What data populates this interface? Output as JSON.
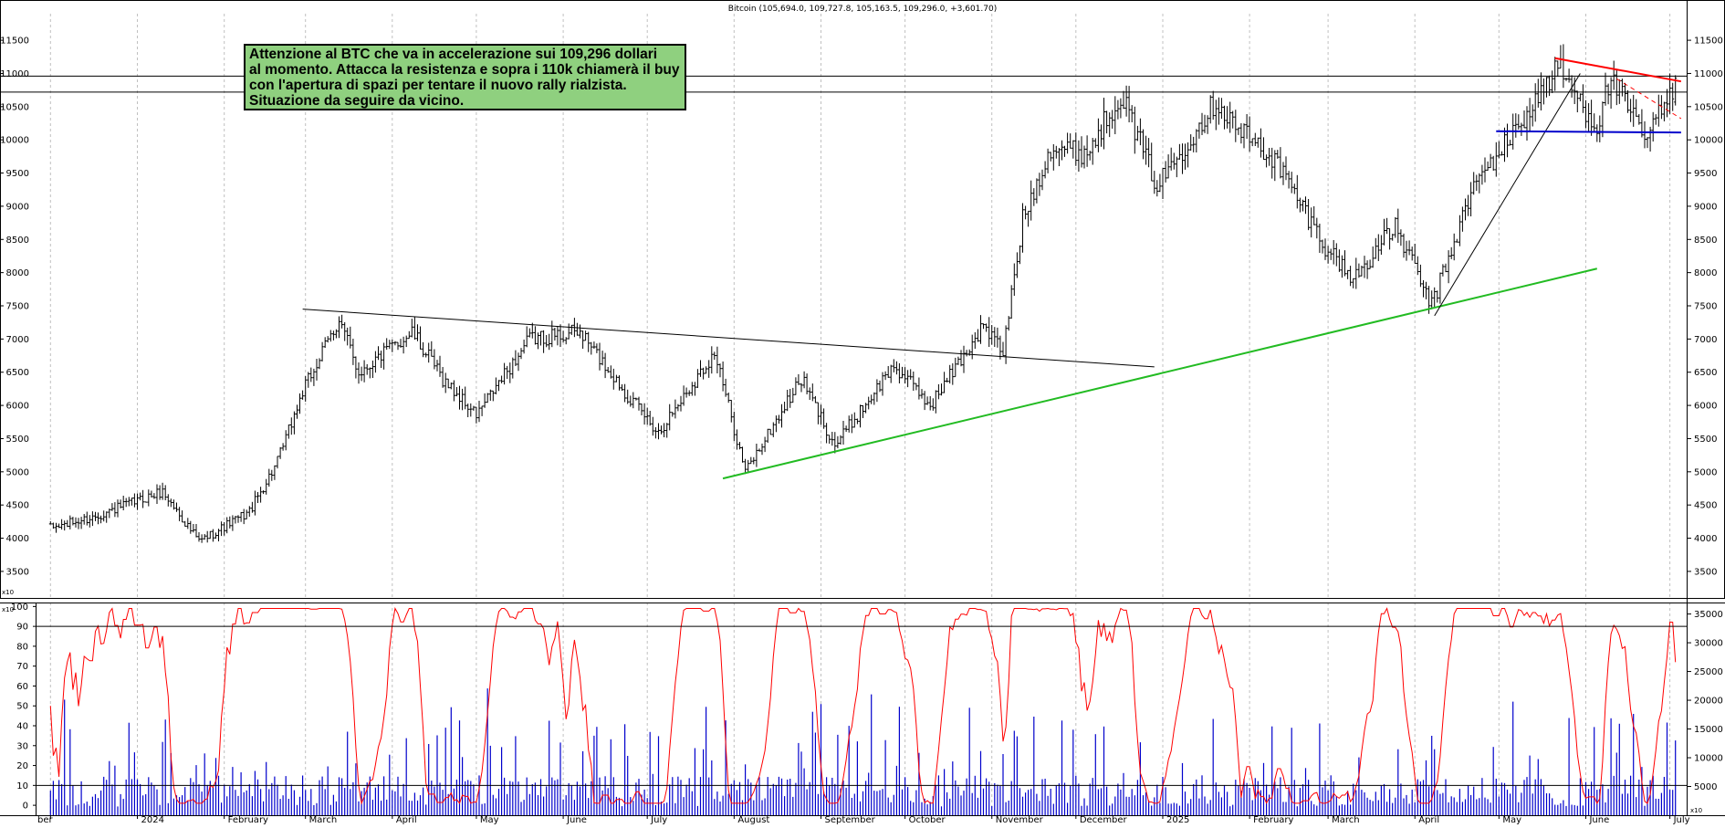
{
  "header": {
    "title": "Bitcoin (105,694.0, 109,727.8, 105,163.5, 109,296.0, +3,601.70)"
  },
  "annotation": {
    "lines": [
      "Attenzione al BTC che va in accelerazione sui 109,296 dollari",
      "al momento. Attacca la resistenza e sopra i 110k chiamerà il buy",
      "con l'apertura di spazi per tentare il nuovo rally rialzista.",
      "Situazione da seguire da vicino."
    ]
  },
  "colors": {
    "price_bars": "#000000",
    "trendline_green": "#22bb22",
    "resistance_red": "#ff0000",
    "support_blue": "#0000cc",
    "stochastic_line": "#ff0000",
    "volume_bars": "#0000cc",
    "gridline": "#c0c0c0"
  },
  "chart_data": [
    {
      "type": "candlestick",
      "title": "Bitcoin",
      "y_scale_label": "x10",
      "ylim": [
        3100,
        11900
      ],
      "yticks": [
        3500,
        4000,
        4500,
        5000,
        5500,
        6000,
        6500,
        7000,
        7500,
        8000,
        8500,
        9000,
        9500,
        10000,
        10500,
        11000,
        11500
      ],
      "x_month_labels": [
        "ber",
        "2024",
        "February",
        "March",
        "April",
        "May",
        "June",
        "July",
        "August",
        "September",
        "October",
        "November",
        "December",
        "2025",
        "February",
        "March",
        "April",
        "May",
        "June",
        "July"
      ],
      "grid": true,
      "anchor_points": [
        {
          "date": "2023-12-01",
          "close": 4150
        },
        {
          "date": "2023-12-15",
          "close": 4300
        },
        {
          "date": "2024-01-10",
          "close": 4700
        },
        {
          "date": "2024-01-23",
          "close": 3950
        },
        {
          "date": "2024-02-10",
          "close": 4400
        },
        {
          "date": "2024-02-20",
          "close": 5150
        },
        {
          "date": "2024-02-29",
          "close": 6200
        },
        {
          "date": "2024-03-13",
          "close": 7300
        },
        {
          "date": "2024-03-20",
          "close": 6500
        },
        {
          "date": "2024-04-08",
          "close": 7100
        },
        {
          "date": "2024-04-19",
          "close": 6400
        },
        {
          "date": "2024-05-01",
          "close": 5850
        },
        {
          "date": "2024-05-20",
          "close": 7000
        },
        {
          "date": "2024-06-07",
          "close": 7100
        },
        {
          "date": "2024-06-25",
          "close": 6100
        },
        {
          "date": "2024-07-05",
          "close": 5600
        },
        {
          "date": "2024-07-25",
          "close": 6800
        },
        {
          "date": "2024-08-05",
          "close": 5000
        },
        {
          "date": "2024-08-25",
          "close": 6400
        },
        {
          "date": "2024-09-06",
          "close": 5400
        },
        {
          "date": "2024-09-27",
          "close": 6600
        },
        {
          "date": "2024-10-10",
          "close": 6000
        },
        {
          "date": "2024-10-29",
          "close": 7200
        },
        {
          "date": "2024-11-05",
          "close": 6800
        },
        {
          "date": "2024-11-12",
          "close": 8800
        },
        {
          "date": "2024-11-22",
          "close": 9900
        },
        {
          "date": "2024-12-05",
          "close": 9800
        },
        {
          "date": "2024-12-17",
          "close": 10700
        },
        {
          "date": "2024-12-30",
          "close": 9300
        },
        {
          "date": "2025-01-20",
          "close": 10600
        },
        {
          "date": "2025-01-27",
          "close": 10200
        },
        {
          "date": "2025-02-10",
          "close": 9700
        },
        {
          "date": "2025-02-28",
          "close": 8400
        },
        {
          "date": "2025-03-10",
          "close": 7900
        },
        {
          "date": "2025-03-25",
          "close": 8700
        },
        {
          "date": "2025-04-07",
          "close": 7500
        },
        {
          "date": "2025-04-22",
          "close": 9300
        },
        {
          "date": "2025-05-08",
          "close": 10200
        },
        {
          "date": "2025-05-22",
          "close": 11100
        },
        {
          "date": "2025-06-05",
          "close": 10200
        },
        {
          "date": "2025-06-10",
          "close": 10950
        },
        {
          "date": "2025-06-22",
          "close": 10000
        },
        {
          "date": "2025-07-01",
          "close": 10650
        },
        {
          "date": "2025-07-03",
          "close": 10930
        }
      ],
      "last_candle": {
        "open": 105694.0,
        "high": 109727.8,
        "low": 105163.5,
        "close": 109296.0,
        "change": 3601.7
      },
      "horizontal_levels": [
        10960,
        10720
      ],
      "trendlines": [
        {
          "name": "descending-resistance-2024",
          "color": "#000000",
          "from": {
            "date": "2024-02-29",
            "price": 7450
          },
          "to": {
            "date": "2024-12-29",
            "price": 6580
          }
        },
        {
          "name": "rising-support-green",
          "color": "#22bb22",
          "from": {
            "date": "2024-07-28",
            "price": 4900
          },
          "to": {
            "date": "2025-06-05",
            "price": 8060
          }
        },
        {
          "name": "rising-support-black",
          "color": "#000000",
          "from": {
            "date": "2025-04-08",
            "price": 7350
          },
          "to": {
            "date": "2025-05-30",
            "price": 11000
          }
        },
        {
          "name": "red-resistance",
          "color": "#ff0000",
          "from": {
            "date": "2025-05-21",
            "price": 11230
          },
          "to": {
            "date": "2025-07-05",
            "price": 10880
          }
        },
        {
          "name": "red-dashed-channel",
          "color": "#ff0000",
          "from": {
            "date": "2025-06-12",
            "price": 10920
          },
          "to": {
            "date": "2025-07-05",
            "price": 10320
          }
        },
        {
          "name": "blue-support",
          "color": "#0000cc",
          "from": {
            "date": "2025-04-30",
            "price": 10130
          },
          "to": {
            "date": "2025-07-05",
            "price": 10110
          }
        }
      ]
    },
    {
      "type": "line",
      "series_label": "stochastic",
      "ylim": [
        -5,
        102
      ],
      "yticks": [
        0,
        10,
        20,
        30,
        40,
        50,
        60,
        70,
        80,
        90,
        100
      ],
      "reference_levels": [
        10,
        90
      ],
      "y2_scale_label": "x10",
      "y2ticks": [
        5000,
        10000,
        15000,
        20000,
        25000,
        30000,
        35000
      ],
      "y2lim": [
        0,
        37000
      ],
      "volume_series": "bar",
      "volume_last": 13000,
      "stochastic_last": 72
    }
  ]
}
